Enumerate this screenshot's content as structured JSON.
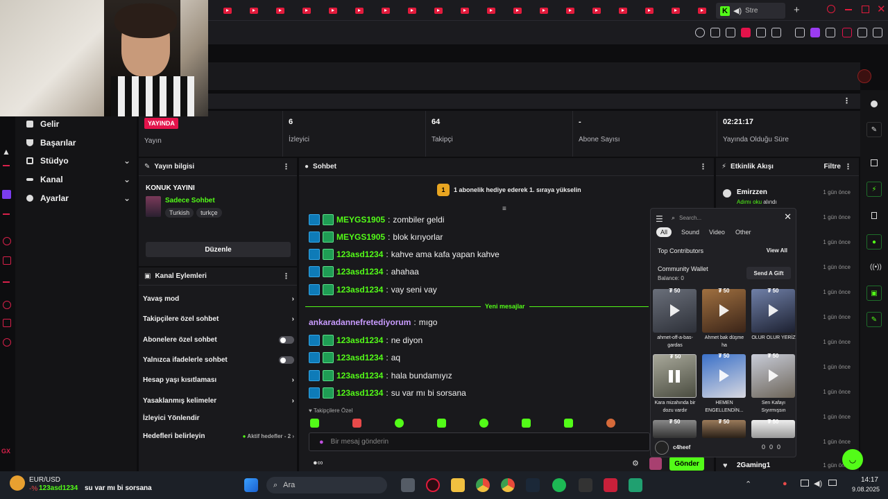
{
  "browser": {
    "active_tab_label": "Stre",
    "tab_count_hint": "15"
  },
  "stats": {
    "live_badge": "YAYINDA",
    "live_label": "Yayın",
    "viewers_value": "6",
    "viewers_label": "İzleyici",
    "followers_value": "64",
    "followers_label": "Takipçi",
    "subs_value": "-",
    "subs_label": "Abone Sayısı",
    "uptime_value": "02:21:17",
    "uptime_label": "Yayında Olduğu Süre"
  },
  "sidebar": {
    "items": [
      {
        "label": "Gelir"
      },
      {
        "label": "Başarılar"
      },
      {
        "label": "Stüdyo"
      },
      {
        "label": "Kanal"
      },
      {
        "label": "Ayarlar"
      }
    ]
  },
  "stream_info": {
    "title": "Yayın bilgisi",
    "stream_title": "KONUK YAYINI",
    "category": "Sadece Sohbet",
    "tags": [
      "Turkish",
      "turkçe"
    ],
    "edit_button": "Düzenle"
  },
  "channel_actions": {
    "title": "Kanal Eylemleri",
    "items": [
      {
        "label": "Yavaş mod"
      },
      {
        "label": "Takipçilere özel sohbet"
      },
      {
        "label": "Abonelere özel sohbet"
      },
      {
        "label": "Yalnızca ifadelerle sohbet"
      },
      {
        "label": "Hesap yaşı kısıtlaması"
      },
      {
        "label": "Yasaklanmış kelimeler"
      },
      {
        "label": "İzleyici Yönlendir"
      },
      {
        "label": "Hedefleri belirleyin"
      }
    ],
    "goals_status": "Aktif hedefler - 2"
  },
  "chat": {
    "title": "Sohbet",
    "pinned_rank": "1",
    "pinned_text": "1 abonelik hediye ederek 1. sıraya yükselin",
    "new_messages_label": "Yeni mesajlar",
    "messages": [
      {
        "user": "MEYGS1905",
        "text": "zombiler geldi"
      },
      {
        "user": "MEYGS1905",
        "text": "blok kırıyorlar"
      },
      {
        "user": "123asd1234",
        "text": "kahve ama kafa yapan kahve"
      },
      {
        "user": "123asd1234",
        "text": "ahahaa"
      },
      {
        "user": "123asd1234",
        "text": "vay seni vay"
      },
      {
        "user": "ankaradannefretediyorum",
        "text": "mıgo"
      },
      {
        "user": "123asd1234",
        "text": "ne diyon"
      },
      {
        "user": "123asd1234",
        "text": "aq"
      },
      {
        "user": "123asd1234",
        "text": "hala bundamıyız"
      },
      {
        "user": "123asd1234",
        "text": "su var mı bi sorsana"
      }
    ],
    "followers_only_label": "Takipçilere Özel",
    "input_placeholder": "Bir mesaj gönderin",
    "send_button": "Gönder"
  },
  "activity": {
    "title": "Etkinlik Akışı",
    "filter": "Filtre",
    "first_user": "Emirzzen",
    "first_detail": "Adımı oku",
    "first_detail_suffix": "alındı",
    "time_ago": "1 gün önce",
    "last_user": "2Gaming1"
  },
  "soundboard": {
    "search_placeholder": "Search...",
    "filters": [
      "All",
      "Sound",
      "Video",
      "Other"
    ],
    "top_contributors": "Top Contributors",
    "view_all": "View All",
    "wallet_title": "Community Wallet",
    "wallet_balance": "Balance: 0",
    "send_gift": "Send A Gift",
    "price": "50",
    "items": [
      {
        "label": "ahmet-off-a-bas-gardas"
      },
      {
        "label": "Ahmet bak düşme ha"
      },
      {
        "label": "OLUR OLUR YERİZ"
      },
      {
        "label": "Kara mizahında bir dozu vardır"
      },
      {
        "label": "HEMEN ENGELLENDİN..."
      },
      {
        "label": "Sen Kafayı Sıyırmışsın"
      }
    ],
    "username": "c4heef",
    "counters": [
      "0",
      "0",
      "0"
    ]
  },
  "ticker": {
    "pair": "EUR/USD",
    "change": "-%",
    "user": "123asd1234",
    "message": "su var mı bi sorsana"
  },
  "taskbar": {
    "search": "Ara",
    "time": "14:17",
    "date": "9.08.2025"
  },
  "colors": {
    "kick_green": "#53fc18",
    "live_red": "#e3134b",
    "bg": "#0d0d0f"
  }
}
